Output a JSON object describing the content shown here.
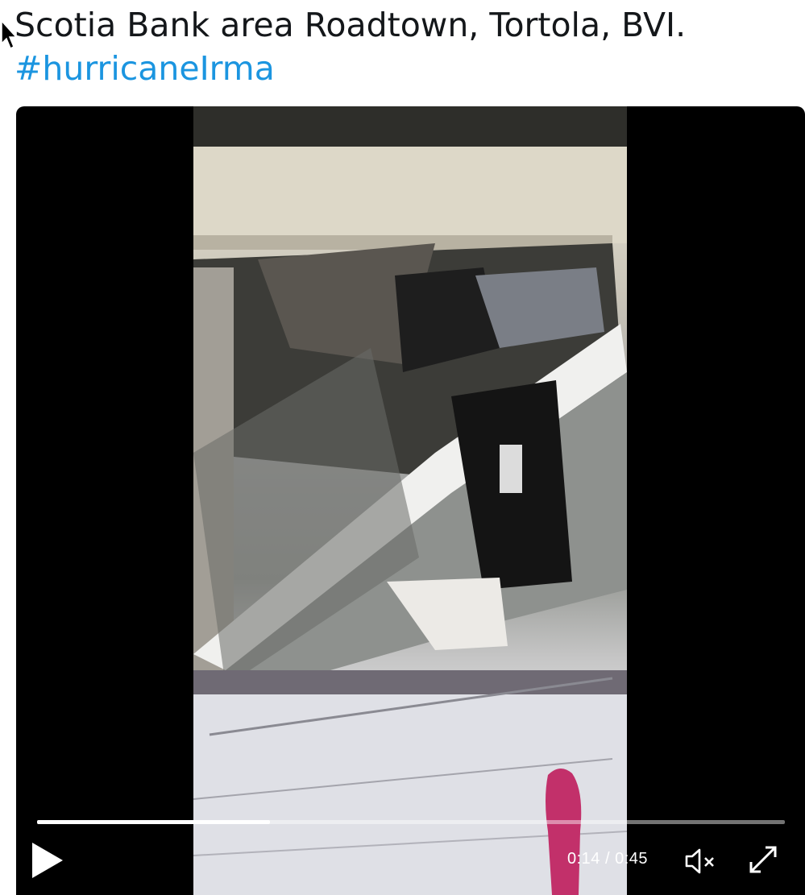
{
  "tweet": {
    "text": "Scotia Bank area Roadtown, Tortola, BVI.",
    "hashtag": "#hurricaneIrma"
  },
  "video": {
    "current_time": "0:14",
    "duration": "0:45",
    "time_display": "0:14 / 0:45",
    "progress_fraction": 0.311
  },
  "icons": {
    "cursor": "mouse-pointer-icon",
    "play": "play-icon",
    "mute": "volume-muted-icon",
    "fullscreen": "fullscreen-expand-icon"
  },
  "colors": {
    "hashtag": "#1b95e0",
    "text": "#14171a",
    "video_bg": "#000000"
  }
}
